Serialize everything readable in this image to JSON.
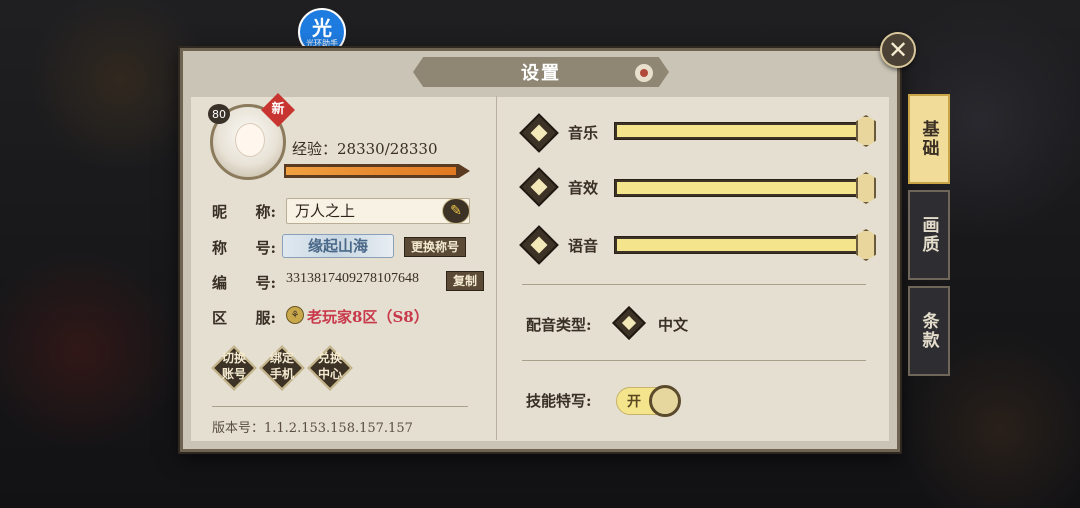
{
  "helper_badge": {
    "big": "光",
    "small": "光环助手"
  },
  "dialog": {
    "title": "设置",
    "close_glyph": "✕"
  },
  "profile": {
    "level": "80",
    "new_badge": "新",
    "exp_text": "经验：28330/28330",
    "exp_progress": 1.0,
    "nickname_label": [
      "昵",
      "称:"
    ],
    "nickname": "万人之上",
    "title_label": [
      "称",
      "号:"
    ],
    "title_value": "缘起山海",
    "change_title_button": "更换称号",
    "id_label": [
      "编",
      "号:"
    ],
    "id_value": "3313817409278107648",
    "copy_button": "复制",
    "server_label": [
      "区",
      "服:"
    ],
    "server_value": "老玩家8区（S8）",
    "actions": [
      {
        "line1": "切换",
        "line2": "账号"
      },
      {
        "line1": "绑定",
        "line2": "手机"
      },
      {
        "line1": "兑换",
        "line2": "中心"
      }
    ],
    "version": "版本号：1.1.2.153.158.157.157"
  },
  "audio": {
    "sliders": [
      {
        "label": "音乐",
        "value": 1.0
      },
      {
        "label": "音效",
        "value": 1.0
      },
      {
        "label": "语音",
        "value": 1.0
      }
    ],
    "voice_type_label": "配音类型:",
    "voice_type_value": "中文",
    "skill_closeup_label": "技能特写:",
    "skill_closeup_toggle": "开"
  },
  "side_tabs": [
    {
      "label": "基础",
      "active": true
    },
    {
      "label": "画质",
      "active": false
    },
    {
      "label": "条款",
      "active": false
    }
  ],
  "colors": {
    "accent_yellow": "#f4e48c",
    "server_red": "#c8384a",
    "tab_active": "#f2dc9a"
  }
}
